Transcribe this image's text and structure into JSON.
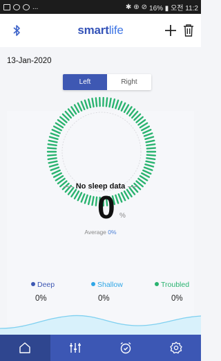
{
  "status_bar": {
    "left_text": "...",
    "right_text": "16% ▮ 오전 11:2"
  },
  "header": {
    "logo_smart": "smart",
    "logo_life": "life",
    "icons": [
      "bluetooth-icon",
      "plus-icon",
      "trash-icon"
    ]
  },
  "date": "13-Jan-2020",
  "side_toggle": {
    "options": [
      "Left",
      "Right"
    ],
    "selected": "Left"
  },
  "sleep": {
    "message": "No sleep data",
    "score": "0",
    "unit": "%",
    "average_label": "Average",
    "average_value": "0%"
  },
  "legend": [
    {
      "label": "Deep",
      "value": "0%",
      "color": "#3e58b3"
    },
    {
      "label": "Shallow",
      "value": "0%",
      "color": "#2fa6e6"
    },
    {
      "label": "Troubled",
      "value": "0%",
      "color": "#29b36f"
    }
  ],
  "nav": {
    "tabs": [
      "home-icon",
      "equalizer-icon",
      "alarm-icon",
      "settings-icon"
    ],
    "active": "home-icon"
  },
  "colors": {
    "primary": "#3c57b4",
    "ring": "#29b36f",
    "wave": "#7fd0f0"
  }
}
